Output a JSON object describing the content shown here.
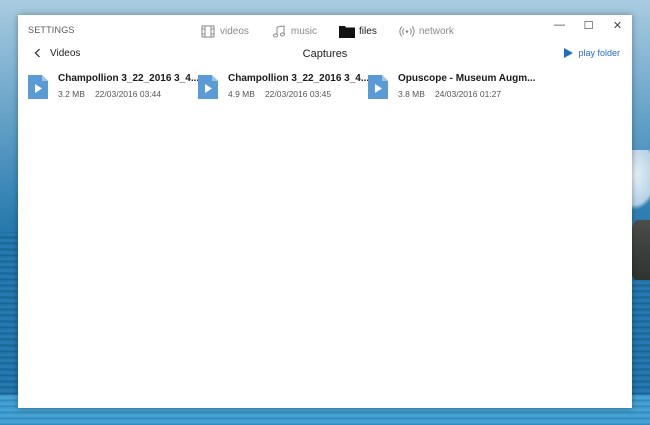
{
  "window": {
    "settings_label": "SETTINGS"
  },
  "nav": {
    "tabs": [
      {
        "label": "videos",
        "icon": "film-icon",
        "active": false
      },
      {
        "label": "music",
        "icon": "music-note-icon",
        "active": false
      },
      {
        "label": "files",
        "icon": "folder-icon",
        "active": true
      },
      {
        "label": "network",
        "icon": "network-icon",
        "active": false
      }
    ]
  },
  "window_controls": {
    "minimize": "—",
    "maximize": "☐",
    "close": "✕"
  },
  "subheader": {
    "back_label": "Videos",
    "title": "Captures",
    "play_folder_label": "play folder"
  },
  "files": [
    {
      "name": "Champollion 3_22_2016 3_4...",
      "size": "3.2 MB",
      "date": "22/03/2016 03:44"
    },
    {
      "name": "Champollion 3_22_2016 3_4...",
      "size": "4.9 MB",
      "date": "22/03/2016 03:45"
    },
    {
      "name": "Opuscope - Museum Augm...",
      "size": "3.8 MB",
      "date": "24/03/2016 01:27"
    }
  ],
  "colors": {
    "accent": "#1e6fbf",
    "file_icon": "#5b9bd5",
    "window_bg": "#ffffff"
  }
}
